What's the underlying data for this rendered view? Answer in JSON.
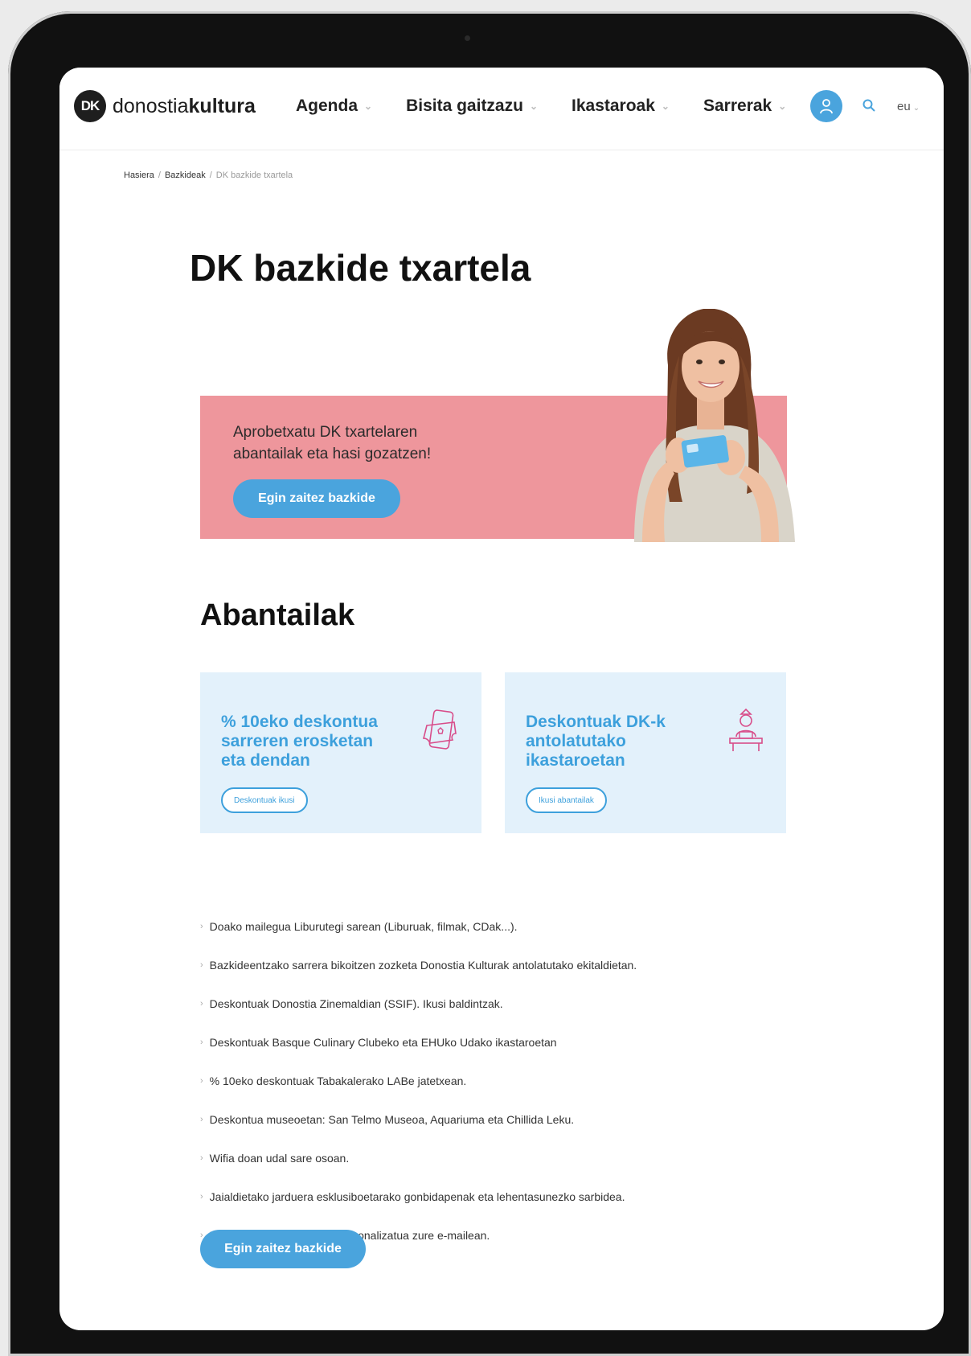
{
  "header": {
    "logo_mark": "DK",
    "logo_text_light": "donostia",
    "logo_text_bold": "kultura",
    "nav": [
      {
        "label": "Agenda"
      },
      {
        "label": "Bisita gaitzazu"
      },
      {
        "label": "Ikastaroak"
      },
      {
        "label": "Sarrerak"
      }
    ],
    "language": "eu"
  },
  "breadcrumb": {
    "items": [
      "Hasiera",
      "Bazkideak",
      "DK bazkide txartela"
    ]
  },
  "page": {
    "title": "DK bazkide txartela"
  },
  "promo": {
    "text": "Aprobetxatu DK txartelaren abantailak eta hasi gozatzen!",
    "button": "Egin zaitez bazkide",
    "bg_color": "#ee969c"
  },
  "advantages": {
    "title": "Abantailak",
    "cards": [
      {
        "title": "% 10eko deskontua sarreren erosketan eta dendan",
        "button": "Deskontuak ikusi",
        "icon": "mobile-ticket-icon"
      },
      {
        "title": "Deskontuak DK-k antolatutako ikastaroetan",
        "button": "Ikusi abantailak",
        "icon": "student-desk-icon"
      }
    ],
    "list": [
      "Doako mailegua Liburutegi sarean (Liburuak, filmak, CDak...).",
      "Bazkideentzako sarrera bikoitzen zozketa Donostia Kulturak antolatutako ekitaldietan.",
      "Deskontuak Donostia Zinemaldian (SSIF). Ikusi baldintzak.",
      "Deskontuak Basque Culinary Clubeko eta EHUko Udako ikastaroetan",
      "% 10eko deskontuak Tabakalerako LABe jatetxean.",
      "Deskontua museoetan: San Telmo Museoa, Aquariuma eta Chillida Leku.",
      "Wifia doan udal sare osoan.",
      "Jaialdietako jarduera esklusiboetarako gonbidapenak eta lehentasunezko sarbidea.",
      "Buletinak eta informazio pertsonalizatua zure e-mailean."
    ],
    "cta": "Egin zaitez bazkide"
  },
  "colors": {
    "accent": "#4aa4dd",
    "card_bg": "#e3f1fb",
    "icon_pink": "#d84d8a"
  }
}
